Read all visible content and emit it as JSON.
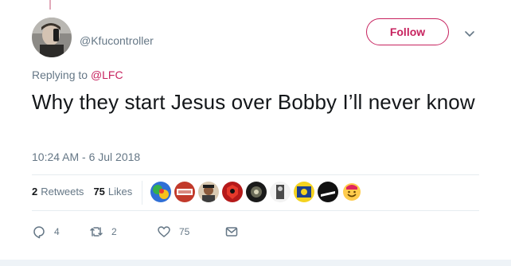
{
  "tweet": {
    "handle": "@Kfucontroller",
    "follow_label": "Follow",
    "replying_prefix": "Replying to",
    "replying_to": "@LFC",
    "text": "Why they start Jesus over Bobby I’ll never know",
    "timestamp": "10:24 AM - 6 Jul 2018"
  },
  "stats": {
    "retweets_count": "2",
    "retweets_label": "Retweets",
    "likes_count": "75",
    "likes_label": "Likes"
  },
  "likers": [
    {
      "name": "liker-avatar-1"
    },
    {
      "name": "liker-avatar-2"
    },
    {
      "name": "liker-avatar-3"
    },
    {
      "name": "liker-avatar-4"
    },
    {
      "name": "liker-avatar-5"
    },
    {
      "name": "liker-avatar-6"
    },
    {
      "name": "liker-avatar-7"
    },
    {
      "name": "liker-avatar-8"
    },
    {
      "name": "liker-avatar-9"
    }
  ],
  "actions": {
    "reply_count": "4",
    "retweet_count": "2",
    "like_count": "75"
  },
  "icons": {
    "reply": "reply-icon",
    "retweet": "retweet-icon",
    "like": "heart-icon",
    "dm": "envelope-icon",
    "caret": "chevron-down-icon"
  },
  "colors": {
    "accent": "#c7235f",
    "secondary_text": "#657786",
    "primary_text": "#14171a"
  }
}
